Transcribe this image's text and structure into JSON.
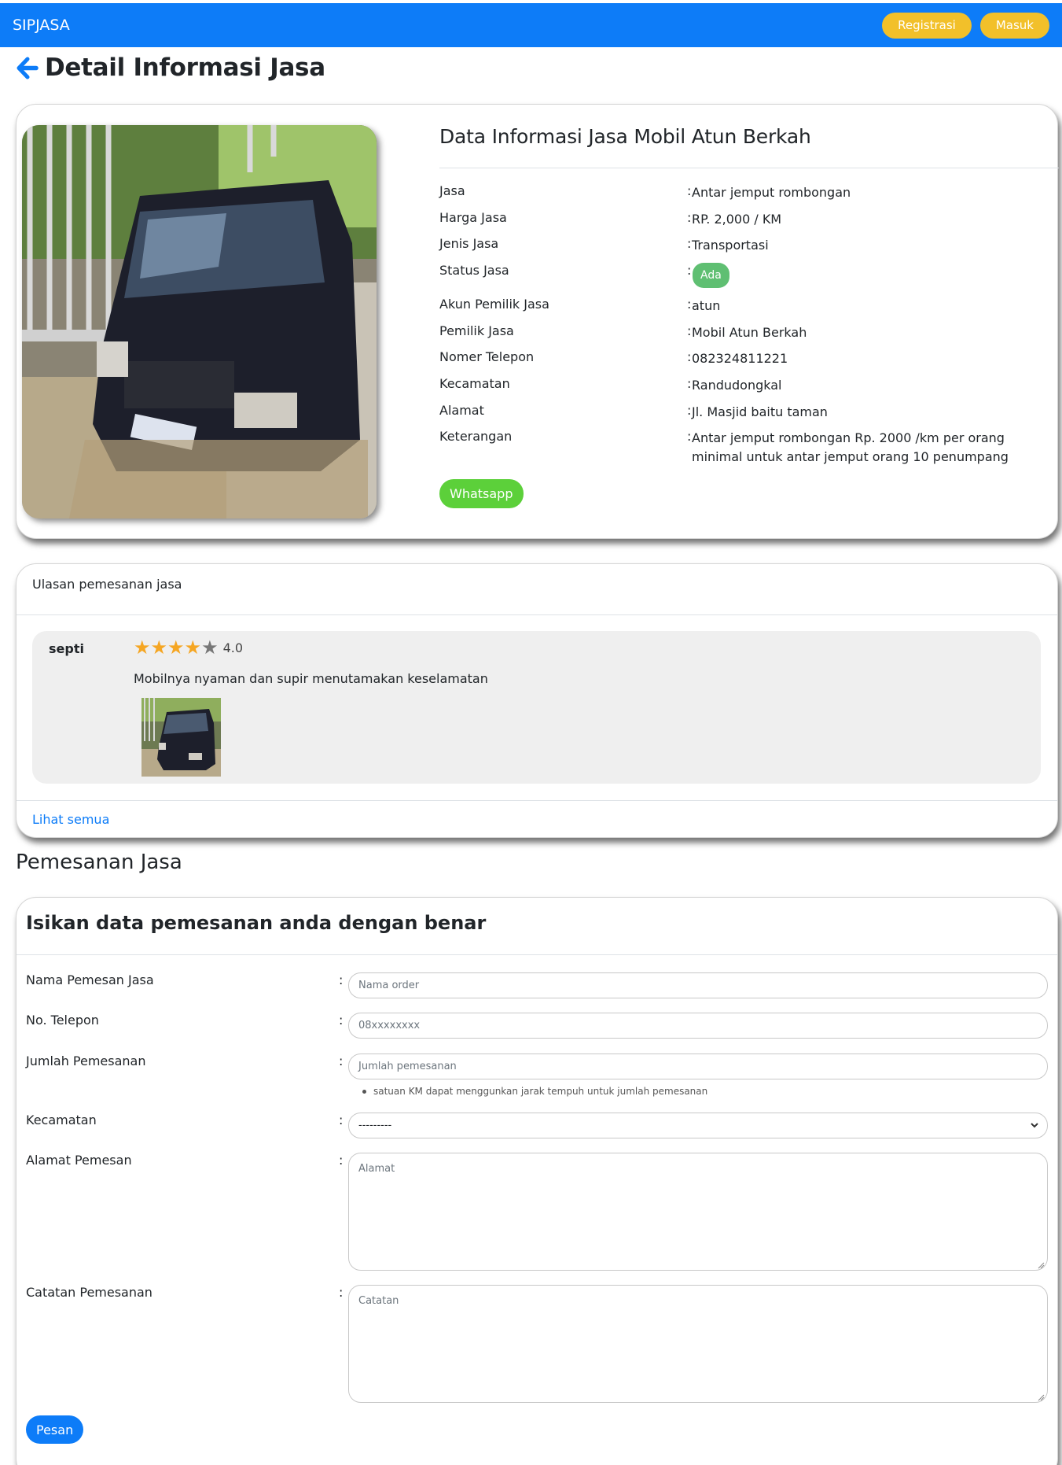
{
  "navbar": {
    "brand": "SIPJASA",
    "register_label": "Registrasi",
    "login_label": "Masuk"
  },
  "page": {
    "title": "Detail Informasi Jasa",
    "back_icon": "arrow-left-icon"
  },
  "detail": {
    "title": "Data Informasi Jasa Mobil Atun Berkah",
    "rows": [
      {
        "label": "Jasa",
        "value": "Antar jemput rombongan"
      },
      {
        "label": "Harga Jasa",
        "value": "RP. 2,000 / KM"
      },
      {
        "label": "Jenis Jasa",
        "value": "Transportasi"
      },
      {
        "label": "Status Jasa",
        "value": "Ada"
      },
      {
        "label": "Akun Pemilik Jasa",
        "value": "atun"
      },
      {
        "label": "Pemilik Jasa",
        "value": "Mobil Atun Berkah"
      },
      {
        "label": "Nomer Telepon",
        "value": "082324811221"
      },
      {
        "label": "Kecamatan",
        "value": "Randudongkal"
      },
      {
        "label": "Alamat",
        "value": "Jl. Masjid baitu taman"
      },
      {
        "label": "Keterangan",
        "value": "Antar jemput rombongan Rp. 2000 /km per orang minimal untuk antar jemput orang 10 penumpang"
      }
    ],
    "whatsapp_label": "Whatsapp",
    "colon": ":"
  },
  "reviews": {
    "header": "Ulasan pemesanan jasa",
    "items": [
      {
        "name": "septi",
        "rating": "4.0",
        "rating_value": 4,
        "rating_max": 5,
        "text": "Mobilnya nyaman dan supir menutamakan keselamatan"
      }
    ],
    "see_all_label": "Lihat semua",
    "star_color": "#f5a623"
  },
  "order": {
    "section_title": "Pemesanan Jasa",
    "form_title": "Isikan data pemesanan anda dengan benar",
    "fields": {
      "name": {
        "label": "Nama Pemesan Jasa",
        "placeholder": "Nama order"
      },
      "phone": {
        "label": "No. Telepon",
        "placeholder": "08xxxxxxxx"
      },
      "qty": {
        "label": "Jumlah Pemesanan",
        "placeholder": "Jumlah pemesanan",
        "hint": "satuan KM dapat menggunkan jarak tempuh untuk jumlah pemesanan"
      },
      "district": {
        "label": "Kecamatan",
        "selected": "---------"
      },
      "address": {
        "label": "Alamat Pemesan",
        "placeholder": "Alamat"
      },
      "note": {
        "label": "Catatan Pemesanan",
        "placeholder": "Catatan"
      }
    },
    "submit_label": "Pesan"
  },
  "colors": {
    "primary": "#0d7cf8",
    "warning": "#f2c02a",
    "success": "#5cd03a",
    "badge": "#5fbf72"
  }
}
